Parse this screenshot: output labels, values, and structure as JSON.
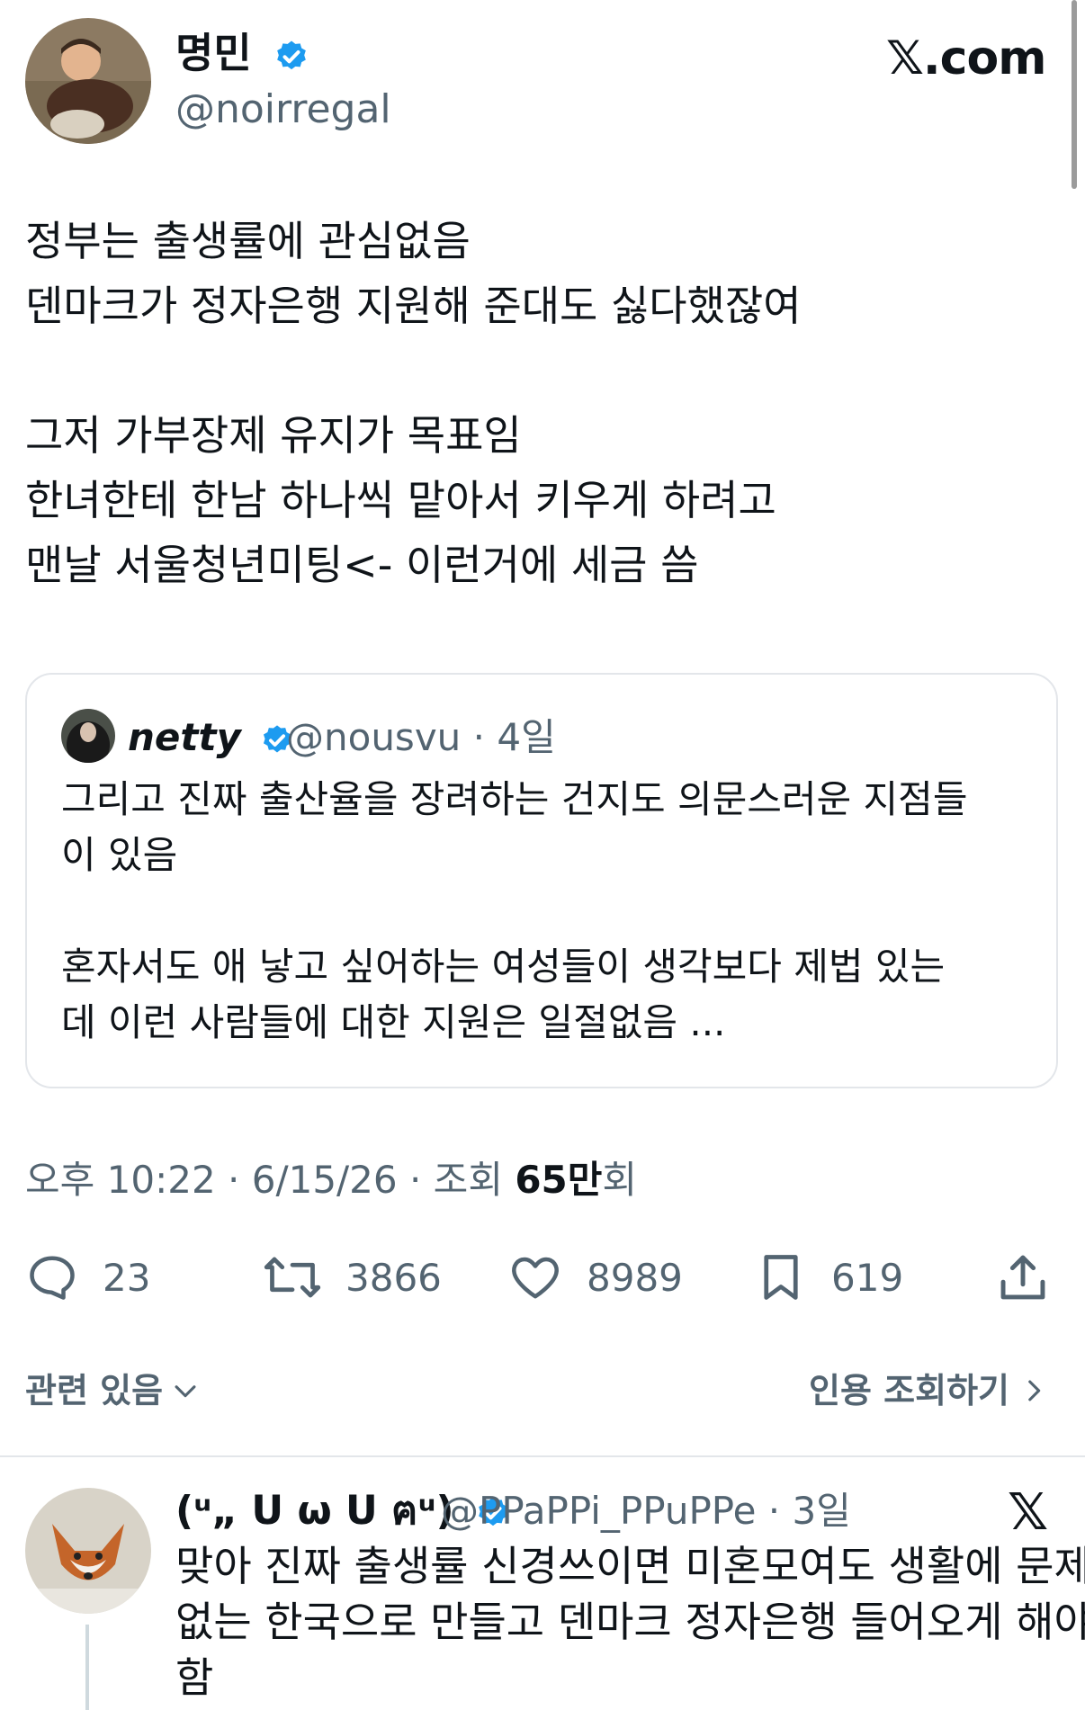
{
  "tweet": {
    "author_name": "명민",
    "author_handle": "@noirregal",
    "site_logo": "𝕏.com",
    "body_lines": [
      "정부는 출생률에 관심없음",
      "덴마크가 정자은행 지원해 준대도 싫다했잖여",
      "",
      "그저 가부장제 유지가 목표임",
      "한녀한테 한남 하나씩 맡아서 키우게 하려고",
      "맨날 서울청년미팅<- 이런거에 세금 씀"
    ],
    "quoted": {
      "name": "netty",
      "handle_time": "@nousvu · 4일",
      "lines": [
        "그리고 진짜 출산율을 장려하는 건지도 의문스러운 지점들",
        "이 있음",
        "",
        "혼자서도 애 낳고 싶어하는 여성들이 생각보다 제법 있는",
        "데 이런 사람들에 대한 지원은 일절없음 ..."
      ]
    },
    "meta": {
      "prefix": "오후 10:22 · 6/15/26 · 조회 ",
      "views": "65만",
      "suffix": "회"
    },
    "actions": {
      "replies": "23",
      "retweets": "3866",
      "likes": "8989",
      "bookmarks": "619"
    },
    "related_label": "관련 있음",
    "quotes_label": "인용 조회하기"
  },
  "reply": {
    "name": "(ᵘ„ ᑌ ω ᑌ ฅᵘ)",
    "handle_time": "@PPaPPi_PPuPPe · 3일",
    "x_logo": "𝕏",
    "lines": [
      "맞아 진짜 출생률 신경쓰이면 미혼모여도 생활에 문제",
      "없는 한국으로 만들고 덴마크 정자은행 들어오게 해야",
      "함"
    ]
  },
  "colors": {
    "verified_blue": "#1d9bf0",
    "muted_text": "#536471",
    "border": "#e3e6ea"
  }
}
